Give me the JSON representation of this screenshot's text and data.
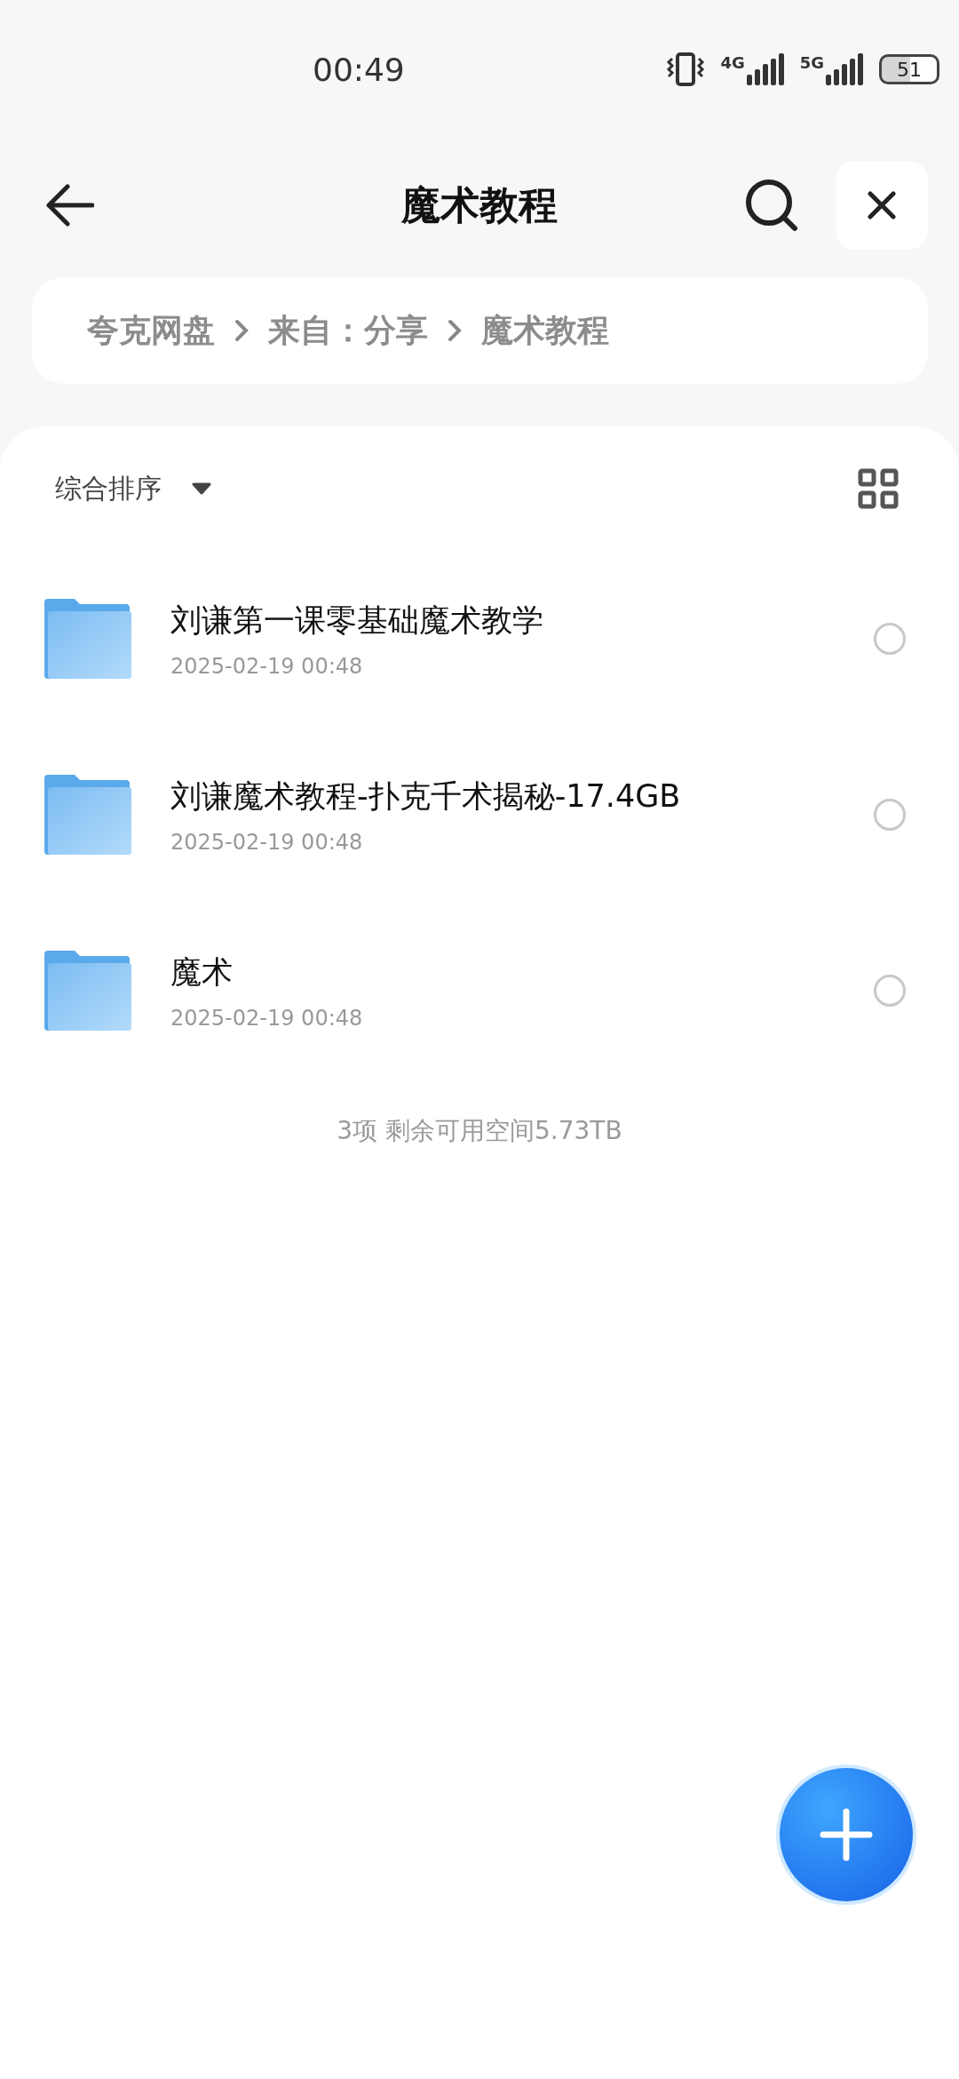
{
  "status_bar": {
    "time": "00:49",
    "network_1": "4G",
    "network_2": "5G",
    "battery": "51"
  },
  "header": {
    "title": "魔术教程"
  },
  "breadcrumb": [
    "夸克网盘",
    "来自：分享",
    "魔术教程"
  ],
  "sort": {
    "label": "综合排序"
  },
  "files": [
    {
      "name": "刘谦第一课零基础魔术教学",
      "date": "2025-02-19 00:48",
      "selected": false
    },
    {
      "name": "刘谦魔术教程-扑克千术揭秘-17.4GB",
      "date": "2025-02-19 00:48",
      "selected": false
    },
    {
      "name": "魔术",
      "date": "2025-02-19 00:48",
      "selected": false
    }
  ],
  "footer": "3项 剩余可用空间5.73TB"
}
